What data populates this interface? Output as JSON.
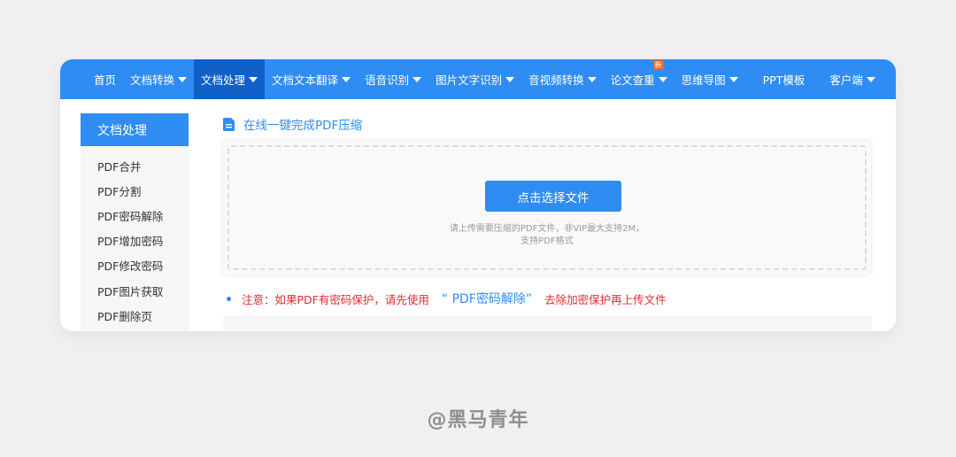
{
  "nav": {
    "items": [
      {
        "label": "首页",
        "dropdown": false
      },
      {
        "label": "文档转换",
        "dropdown": true
      },
      {
        "label": "文档处理",
        "dropdown": true,
        "active": true
      },
      {
        "label": "文档文本翻译",
        "dropdown": true
      },
      {
        "label": "语音识别",
        "dropdown": true
      },
      {
        "label": "图片文字识别",
        "dropdown": true
      },
      {
        "label": "音视频转换",
        "dropdown": true
      },
      {
        "label": "论文查重",
        "dropdown": true,
        "badge": "新"
      },
      {
        "label": "思维导图",
        "dropdown": true
      },
      {
        "label": "PPT模板",
        "dropdown": false
      },
      {
        "label": "客户端",
        "dropdown": true
      }
    ]
  },
  "sidebar": {
    "title": "文档处理",
    "items": [
      "PDF合并",
      "PDF分割",
      "PDF密码解除",
      "PDF增加密码",
      "PDF修改密码",
      "PDF图片获取",
      "PDF删除页"
    ]
  },
  "main": {
    "section_title": "在线一键完成PDF压缩",
    "upload_button": "点击选择文件",
    "hint_line1": "请上传需要压缩的PDF文件，非VIP最大支持2M，",
    "hint_line2": "支持PDF格式",
    "notice_prefix": "注意：如果PDF有密码保护，请先使用",
    "notice_link": "“ PDF密码解除”",
    "notice_suffix": "去除加密保护再上传文件"
  },
  "watermark": "@黑马青年",
  "colors": {
    "primary": "#2f8cf2",
    "nav_active": "#1160c8",
    "notice_red": "#e8292d",
    "badge_orange": "#f56a1d"
  }
}
